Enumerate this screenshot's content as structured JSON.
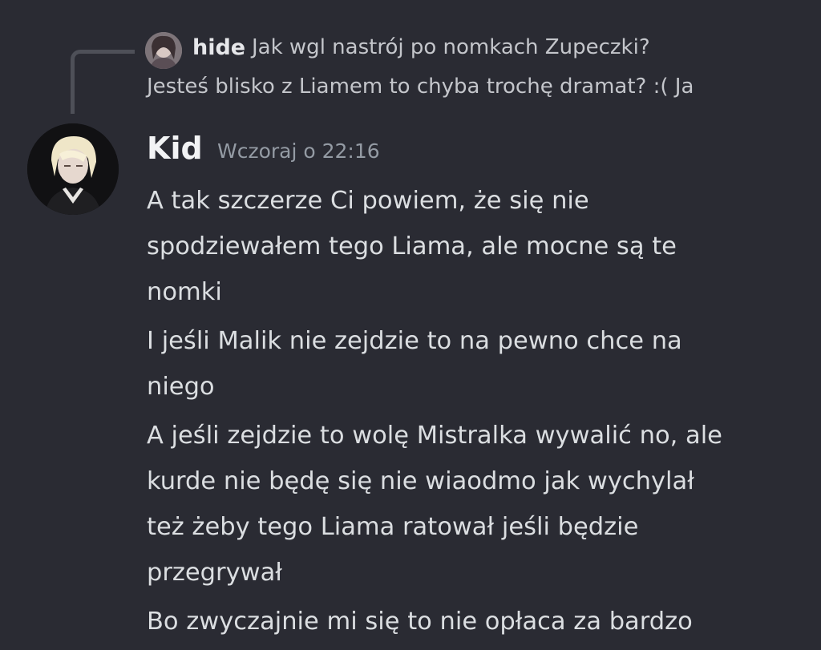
{
  "reply": {
    "author": "hide",
    "text_line1": "Jak wgl nastrój po nomkach Zupeczki?",
    "text_line2": "Jesteś blisko z Liamem to chyba trochę dramat? :( Ja",
    "avatar_icon": "user-avatar-icon"
  },
  "message": {
    "author": "Kid",
    "timestamp": "Wczoraj o 22:16",
    "avatar_icon": "user-avatar-icon",
    "lines": [
      "A tak szczerze Ci powiem, że się nie\nspodziewałem tego Liama, ale mocne są te\nnomki",
      "I jeśli Malik nie zejdzie to na pewno chce na\nniego",
      "A jeśli zejdzie to wolę Mistralka wywalić no, ale\nkurde nie będę się nie wiaodmo jak wychylał\nteż żeby tego Liama ratował jeśli będzie\nprzegrywał",
      "Bo zwyczajnie mi się to nie opłaca za bardzo"
    ]
  },
  "colors": {
    "background": "#2a2b33",
    "text": "#dbdee1",
    "muted": "#949ba4",
    "reply_line": "#4e5058"
  }
}
